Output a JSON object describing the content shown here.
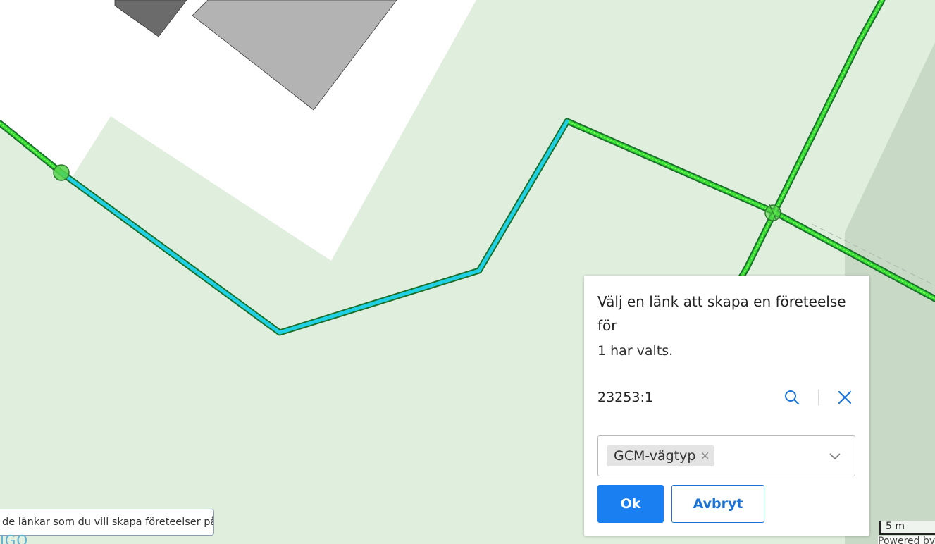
{
  "map": {
    "colors": {
      "background": "#dfeedd",
      "plot_area": "#ffffff",
      "building_dark": "#6b6b6b",
      "building_light": "#b3b3b3",
      "field_dark": "#c8dac5",
      "link_outline": "#1b6e2c",
      "link_fill": "#33dd33",
      "selected_link": "#1ecfe6"
    },
    "hint_tooltip": "de länkar som du vill skapa företeelser på",
    "logo_fragment": "IGO",
    "scale_label": "5 m",
    "attribution": "Powered by"
  },
  "dialog": {
    "title": "Välj en länk att skapa en företeelse för",
    "count_text": "1 har valts.",
    "selected_id": "23253:1",
    "zoom_icon": "search-icon",
    "remove_icon": "close-icon",
    "chip_label": "GCM-vägtyp",
    "chip_remove": "×",
    "ok_label": "Ok",
    "cancel_label": "Avbryt"
  }
}
